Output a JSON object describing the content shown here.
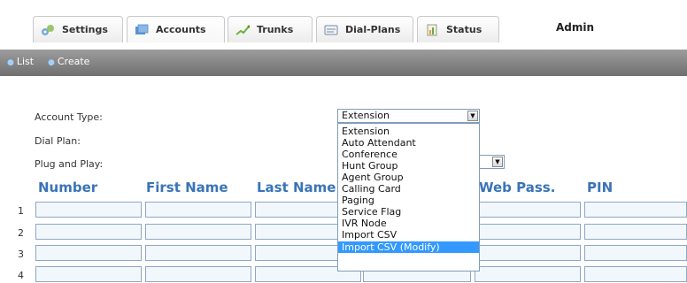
{
  "tabs": {
    "settings": "Settings",
    "accounts": "Accounts",
    "trunks": "Trunks",
    "dialplans": "Dial-Plans",
    "status": "Status"
  },
  "user": "Admin",
  "subnav": {
    "list": "List",
    "create": "Create"
  },
  "form": {
    "account_type_label": "Account Type:",
    "dial_plan_label": "Dial Plan:",
    "plug_and_play_label": "Plug and Play:",
    "account_type_value": "Extension"
  },
  "grid": {
    "headers": [
      "Number",
      "First Name",
      "Last Name",
      "Web Pass.",
      "PIN"
    ],
    "row_numbers": [
      "1",
      "2",
      "3",
      "4"
    ]
  },
  "dropdown": {
    "options": [
      "Extension",
      "Auto Attendant",
      "Conference",
      "Hunt Group",
      "Agent Group",
      "Calling Card",
      "Paging",
      "Service Flag",
      "IVR Node",
      "Import CSV",
      "Import CSV (Modify)"
    ],
    "highlighted": "Import CSV (Modify)"
  },
  "colors": {
    "header_blue": "#3a74b7",
    "selected_option": "#3399ff",
    "subnav_gray": "#7a7a7a"
  }
}
